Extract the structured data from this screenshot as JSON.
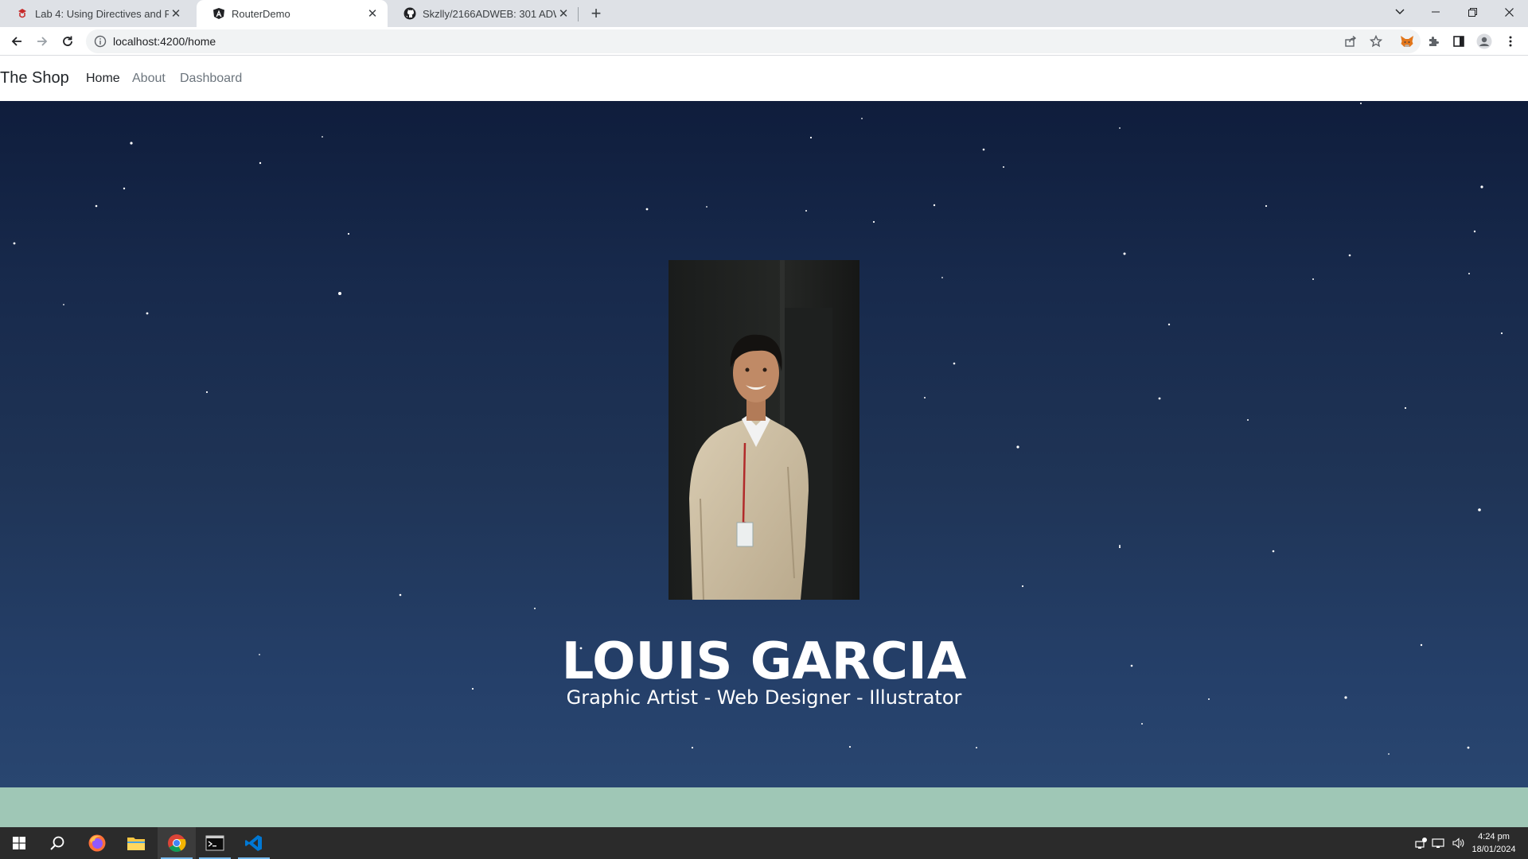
{
  "browser": {
    "tabs": [
      {
        "title": "Lab 4: Using Directives and Routi",
        "favicon": "graduation-icon",
        "active": false
      },
      {
        "title": "RouterDemo",
        "favicon": "angular-icon",
        "active": true
      },
      {
        "title": "Skzlly/2166ADWEB: 301 ADWEB",
        "favicon": "github-icon",
        "active": false
      }
    ],
    "url": "localhost:4200/home"
  },
  "navbar": {
    "brand": "The Shop",
    "links": [
      {
        "label": "Home",
        "active": true
      },
      {
        "label": "About",
        "active": false
      },
      {
        "label": "Dashboard",
        "active": false
      }
    ]
  },
  "hero": {
    "name": "LOUIS GARCIA",
    "subtitle": "Graphic Artist - Web Designer - Illustrator"
  },
  "taskbar": {
    "time": "4:24 pm",
    "date": "18/01/2024"
  },
  "colors": {
    "hero_top": "#0f1d3c",
    "hero_bottom": "#294670",
    "footer_band": "#9fc7b6",
    "taskbar": "#2b2b2b"
  }
}
